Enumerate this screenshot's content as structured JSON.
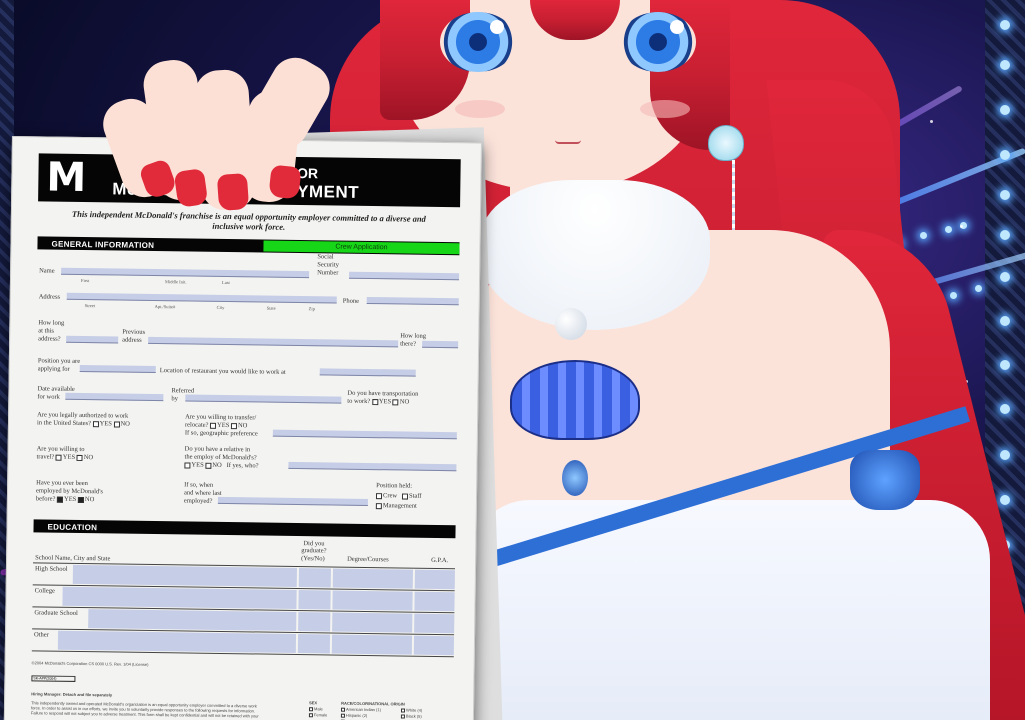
{
  "colors": {
    "hair": "#d8243a",
    "eyes": "#2d7ce6",
    "paper_highlight": "#c6cde6",
    "tag_green": "#17d617",
    "stage_bg": "#1a1650"
  },
  "scene": {
    "subject": "anime-character",
    "icon_logo": "mcdonalds-arches-logo"
  },
  "form": {
    "logo_text": "M",
    "title_line1": "FOR",
    "title_line2": "McDONALD'S EMPLOYMENT",
    "eeo_statement": "This independent McDonald's franchise is an equal opportunity employer committed to a diverse and inclusive work force.",
    "general_section": "GENERAL INFORMATION",
    "crew_tag": "Crew Application",
    "labels": {
      "name": "Name",
      "first": "First",
      "middle": "Middle Init.",
      "last": "Last",
      "ssn1": "Social",
      "ssn2": "Security",
      "ssn3": "Number",
      "address": "Address",
      "street": "Street",
      "apt": "Apt./Suite#",
      "city": "City",
      "state": "State",
      "zip": "Zip",
      "phone": "Phone",
      "howlong1": "How long",
      "howlong2": "at this",
      "howlong3": "address?",
      "prev1": "Previous",
      "prev2": "address",
      "howlong_there1": "How long",
      "howlong_there2": "there?",
      "position1": "Position you are",
      "position2": "applying for",
      "location": "Location of restaurant you would like to work at",
      "date1": "Date available",
      "date2": "for work",
      "ref1": "Referred",
      "ref2": "by",
      "transport1": "Do you have transportation",
      "transport2": "to work?",
      "legal1": "Are you legally authorized to work",
      "legal2": "in the United States?",
      "transfer1": "Are you willing to transfer/",
      "transfer2": "relocate?",
      "transfer3": "If so, geographic preference",
      "travel1": "Are you willing to",
      "travel2": "travel?",
      "relative1": "Do you have a relative in",
      "relative2": "the employ of McDonald's?",
      "relative_who": "If yes, who?",
      "employed1": "Have you ever been",
      "employed2": "employed by McDonald's",
      "employed3": "before?",
      "when1": "If so, when",
      "when2": "and where last",
      "when3": "employed?",
      "position_held": "Position held:",
      "crew": "Crew",
      "staff": "Staff",
      "management": "Management",
      "yes": "YES",
      "no": "NO"
    },
    "education_section": "EDUCATION",
    "education_headers": {
      "school": "School Name, City and State",
      "grad1": "Did you",
      "grad2": "graduate?",
      "grad3": "(Yes/No)",
      "degree": "Degree/Courses",
      "gpa": "G.P.A."
    },
    "education_rows": [
      "High School",
      "College",
      "Graduate School",
      "Other"
    ],
    "footer_copyright": "©2004 McDonald's Corporation   CS 0000 U.S. Rev. 1/04 (License)",
    "footer_box": "SK-APP(2004)",
    "hiring_manager": "Hiring Manager: Detach and file separately",
    "fine_print1": "This independently owned and operated McDonald's organization is an equal opportunity employer committed to a diverse work",
    "fine_print2": "force. In order to assist us in our efforts, we invite you to voluntarily provide responses to the following requests for information.",
    "fine_print3": "Failure to respond will not subject you to adverse treatment. This form shall be kept confidential and will not be retained with your",
    "sex_label": "SEX",
    "male": "Male",
    "female": "Female",
    "race_label": "RACE/COLOR/NATIONAL ORIGIN",
    "race_opts": [
      "American Indian (1)",
      "Hispanic (2)",
      "Asian American (3)",
      "White (4)",
      "Black (5)"
    ]
  }
}
